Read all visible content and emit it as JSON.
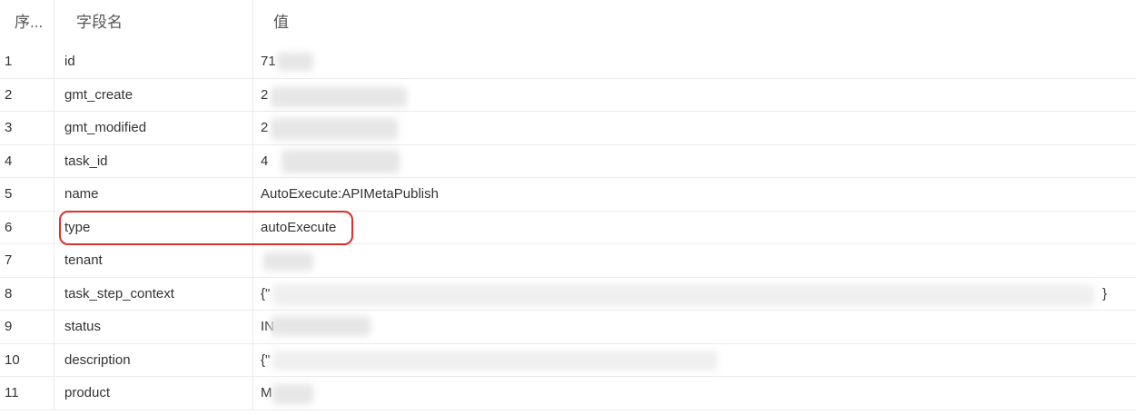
{
  "columns": {
    "index": "序...",
    "field": "字段名",
    "value": "值"
  },
  "rows": [
    {
      "index": "1",
      "field": "id",
      "value": "71"
    },
    {
      "index": "2",
      "field": "gmt_create",
      "value": "2"
    },
    {
      "index": "3",
      "field": "gmt_modified",
      "value": "2"
    },
    {
      "index": "4",
      "field": "task_id",
      "value": "4"
    },
    {
      "index": "5",
      "field": "name",
      "value": "AutoExecute:APIMetaPublish"
    },
    {
      "index": "6",
      "field": "type",
      "value": "autoExecute"
    },
    {
      "index": "7",
      "field": "tenant",
      "value": ""
    },
    {
      "index": "8",
      "field": "task_step_context",
      "value": "{\"",
      "value_end": "}"
    },
    {
      "index": "9",
      "field": "status",
      "value": "IN"
    },
    {
      "index": "10",
      "field": "description",
      "value": "{\""
    },
    {
      "index": "11",
      "field": "product",
      "value": "M"
    }
  ],
  "highlight_color": "#d9312b"
}
